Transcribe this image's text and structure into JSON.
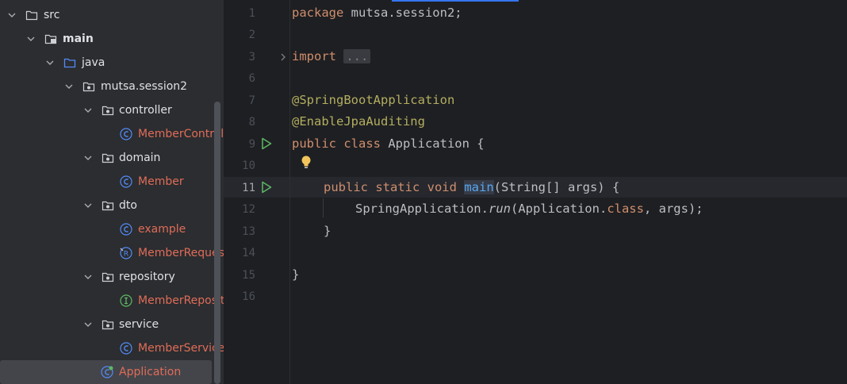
{
  "project_tree": {
    "items": [
      {
        "label": "src",
        "type": "folder"
      },
      {
        "label": "main",
        "type": "source-root"
      },
      {
        "label": "java",
        "type": "java-folder"
      },
      {
        "label": "mutsa.session2",
        "type": "package"
      },
      {
        "label": "controller",
        "type": "package"
      },
      {
        "label": "MemberControl",
        "type": "class"
      },
      {
        "label": "domain",
        "type": "package"
      },
      {
        "label": "Member",
        "type": "class"
      },
      {
        "label": "dto",
        "type": "package"
      },
      {
        "label": "example",
        "type": "class"
      },
      {
        "label": "MemberReques",
        "type": "record"
      },
      {
        "label": "repository",
        "type": "package"
      },
      {
        "label": "MemberReposit",
        "type": "interface"
      },
      {
        "label": "service",
        "type": "package"
      },
      {
        "label": "MemberService",
        "type": "class"
      },
      {
        "label": "Application",
        "type": "spring-boot-class",
        "selected": true
      }
    ]
  },
  "editor": {
    "line_numbers": [
      "1",
      "2",
      "3",
      "6",
      "7",
      "8",
      "9",
      "10",
      "11",
      "12",
      "13",
      "14",
      "15",
      "16"
    ],
    "active_line": "11",
    "code": {
      "package_kw": "package",
      "package_name": " mutsa.session2;",
      "import_kw": "import",
      "import_fold": "...",
      "annotation_1": "@SpringBootApplication",
      "annotation_2": "@EnableJpaAuditing",
      "class_modifiers": "public class",
      "class_decl": " Application {",
      "main_modifiers": "public static void",
      "main_name": "main",
      "main_params": "(String[] args) {",
      "run_prefix": "SpringApplication.",
      "run_method": "run",
      "run_arg_class": "(Application.",
      "run_class_kw": "class",
      "run_args_end": ", args);",
      "close_method": "}",
      "close_class": "}"
    }
  },
  "colors": {
    "tree_bg": "#2b2d30",
    "editor_bg": "#1e1f22",
    "keyword": "#cf8e6d",
    "annotation": "#b3ae60",
    "function": "#56a8f5",
    "class_file_text": "#e06c58",
    "run_icon": "#5fb865",
    "accent": "#3574f0"
  },
  "icons": {
    "run_gutter": "run-icon",
    "intention": "lightbulb-icon",
    "fold": "chevron-right-icon"
  }
}
